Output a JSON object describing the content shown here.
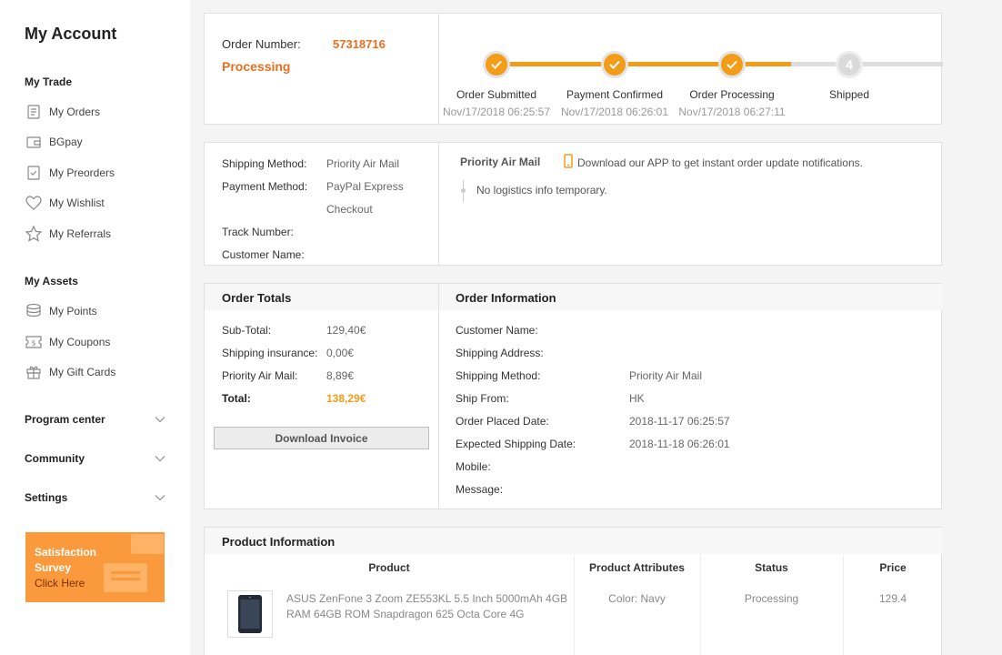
{
  "sidebar": {
    "title": "My Account",
    "trade_header": "My Trade",
    "trade_items": [
      {
        "label": "My Orders",
        "icon": "orders-icon"
      },
      {
        "label": "BGpay",
        "icon": "wallet-icon"
      },
      {
        "label": "My Preorders",
        "icon": "preorder-icon"
      },
      {
        "label": "My Wishlist",
        "icon": "heart-icon"
      },
      {
        "label": "My Referrals",
        "icon": "star-icon"
      }
    ],
    "assets_header": "My Assets",
    "asset_items": [
      {
        "label": "My Points",
        "icon": "coins-icon"
      },
      {
        "label": "My Coupons",
        "icon": "coupon-icon"
      },
      {
        "label": "My Gift Cards",
        "icon": "gift-icon"
      }
    ],
    "collapsibles": [
      "Program center",
      "Community",
      "Settings"
    ],
    "survey": {
      "line1": "Satisfaction",
      "line2": "Survey",
      "cta": "Click Here"
    }
  },
  "order": {
    "number_label": "Order Number:",
    "number": "57318716",
    "status": "Processing",
    "steps": [
      {
        "name": "Order Submitted",
        "date": "Nov/17/2018 06:25:57",
        "done": true
      },
      {
        "name": "Payment Confirmed",
        "date": "Nov/17/2018 06:26:01",
        "done": true
      },
      {
        "name": "Order Processing",
        "date": "Nov/17/2018 06:27:11",
        "done": true
      },
      {
        "name": "Shipped",
        "number": "4",
        "date": "",
        "done": false
      }
    ]
  },
  "shipping": {
    "method_label": "Shipping Method:",
    "method": "Priority Air Mail",
    "payment_label": "Payment Method:",
    "payment_line1": "PayPal Express",
    "payment_line2": "Checkout",
    "track_label": "Track Number:",
    "customer_label": "Customer Name:",
    "logistics_title": "Priority Air Mail",
    "app_note": "Download our APP to get instant order update notifications.",
    "logistics_text": "No logistics info temporary."
  },
  "totals": {
    "title": "Order Totals",
    "rows": [
      {
        "label": "Sub-Total:",
        "value": "129,40€"
      },
      {
        "label": "Shipping insurance:",
        "value": "0,00€"
      },
      {
        "label": "Priority Air Mail:",
        "value": "8,89€"
      }
    ],
    "total_label": "Total:",
    "total_value": "138,29€",
    "download_label": "Download Invoice"
  },
  "order_info": {
    "title": "Order Information",
    "rows": [
      {
        "label": "Customer Name:",
        "value": ""
      },
      {
        "label": "Shipping Address:",
        "value": ""
      },
      {
        "label": "Shipping Method:",
        "value": "Priority Air Mail"
      },
      {
        "label": "Ship From:",
        "value": "HK"
      },
      {
        "label": "Order Placed Date:",
        "value": "2018-11-17 06:25:57"
      },
      {
        "label": "Expected Shipping Date:",
        "value": "2018-11-18 06:26:01"
      },
      {
        "label": "Mobile:",
        "value": ""
      },
      {
        "label": "Message:",
        "value": ""
      }
    ]
  },
  "product_info": {
    "title": "Product Information",
    "columns": [
      "Product",
      "Product Attributes",
      "Status",
      "Price"
    ],
    "items": [
      {
        "name": "ASUS ZenFone 3 Zoom ZE553KL 5.5 Inch 5000mAh 4GB RAM 64GB ROM Snapdragon 625 Octa Core 4G",
        "attributes": "Color: Navy",
        "status": "Processing",
        "price": "129.4"
      }
    ]
  },
  "colors": {
    "accent": "#f39c18",
    "order_number": "#e96e1e",
    "survey_bg": "#fb9a3c"
  }
}
